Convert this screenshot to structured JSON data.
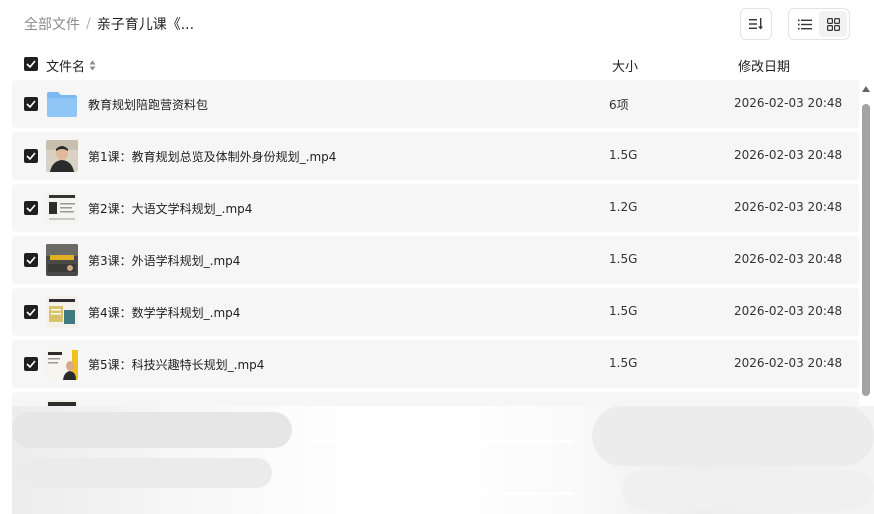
{
  "breadcrumb": {
    "root": "全部文件",
    "separator": "/",
    "current": "亲子育儿课《..."
  },
  "toolbar": {
    "sort_icon": "sort-icon",
    "view_list_icon": "list-view-icon",
    "view_grid_icon": "grid-view-icon",
    "active_view": "list"
  },
  "table": {
    "columns": {
      "name": "文件名",
      "size": "大小",
      "date": "修改日期"
    },
    "select_all_checked": true,
    "rows": [
      {
        "name": "教育规划陪跑营资料包",
        "size": "6项",
        "date": "2026-02-03 20:48",
        "type": "folder",
        "checked": true
      },
      {
        "name": "第1课：教育规划总览及体制外身份规划_.mp4",
        "size": "1.5G",
        "date": "2026-02-03 20:48",
        "type": "video",
        "checked": true
      },
      {
        "name": "第2课：大语文学科规划_.mp4",
        "size": "1.2G",
        "date": "2026-02-03 20:48",
        "type": "video",
        "checked": true
      },
      {
        "name": "第3课：外语学科规划_.mp4",
        "size": "1.5G",
        "date": "2026-02-03 20:48",
        "type": "video",
        "checked": true
      },
      {
        "name": "第4课：数学学科规划_.mp4",
        "size": "1.5G",
        "date": "2026-02-03 20:48",
        "type": "video",
        "checked": true
      },
      {
        "name": "第5课：科技兴趣特长规划_.mp4",
        "size": "1.5G",
        "date": "2026-02-03 20:48",
        "type": "video",
        "checked": true
      }
    ]
  },
  "colors": {
    "row_bg": "#f6f6f7",
    "checkbox": "#1f1f1f",
    "folder": "#8cc2f5"
  }
}
